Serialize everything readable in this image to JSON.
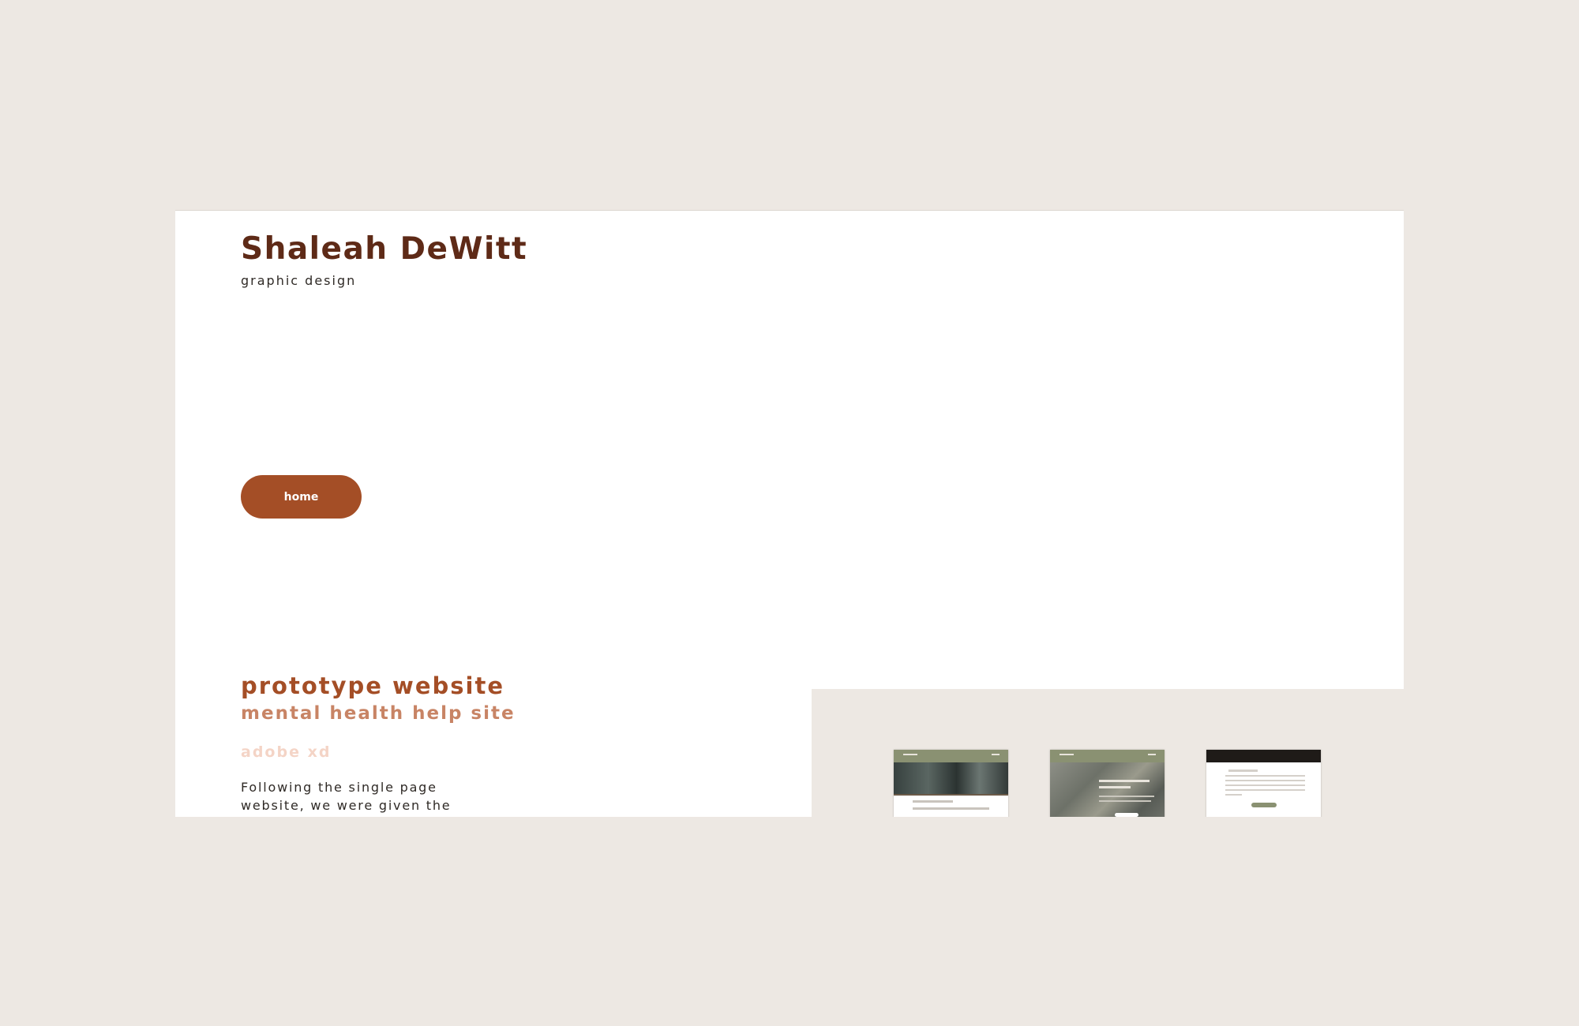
{
  "header": {
    "name": "Shaleah DeWitt",
    "tagline": "graphic design"
  },
  "nav": {
    "home_label": "home"
  },
  "project": {
    "title": "prototype website",
    "subtitle": "mental health help site",
    "tool": "adobe xd",
    "description": "Following the single page website, we were given the"
  },
  "colors": {
    "background": "#ede8e3",
    "name": "#5e2a17",
    "accent": "#a44e26",
    "subtitle": "#c88465",
    "tool": "#f4d4c6",
    "thumb_nav": "#8a9172"
  },
  "gallery": {
    "thumbnails": [
      "prototype-home-thumbnail",
      "prototype-about-thumbnail",
      "prototype-help-thumbnail"
    ]
  }
}
